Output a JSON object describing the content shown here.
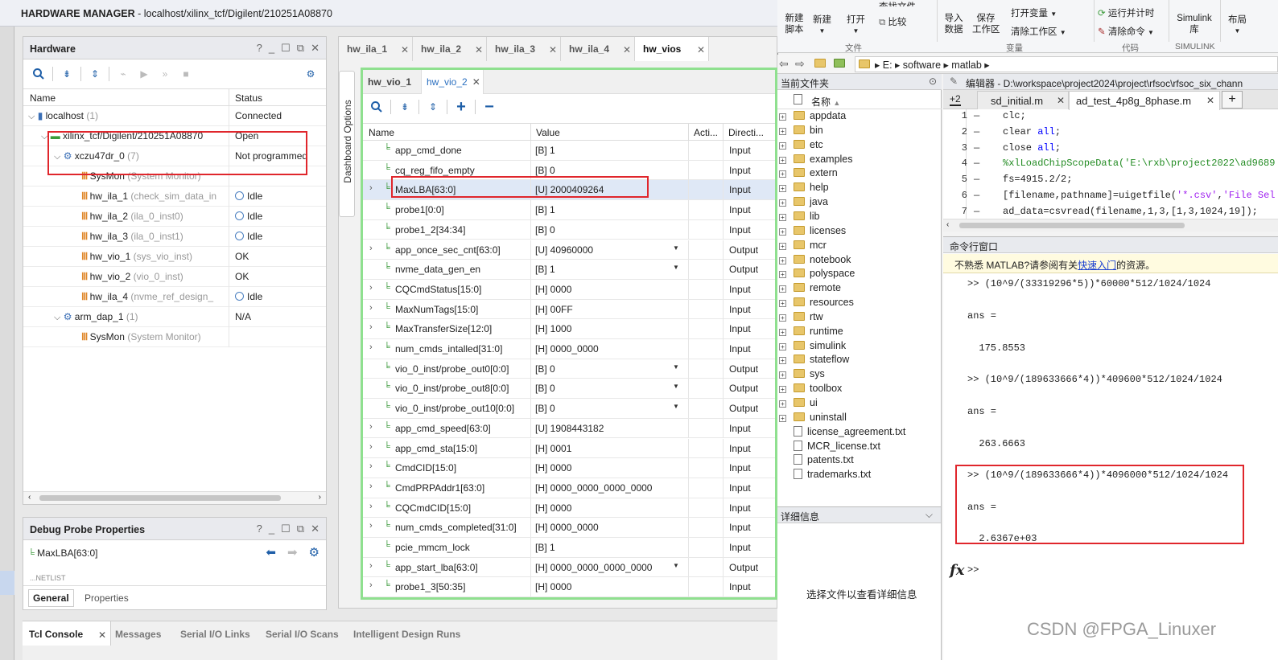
{
  "vivado": {
    "title_bold": "HARDWARE MANAGER",
    "title_rest": " - localhost/xilinx_tcf/Digilent/210251A08870",
    "hardware": {
      "title": "Hardware",
      "col_name": "Name",
      "col_status": "Status",
      "rows": [
        {
          "name": "localhost",
          "extra": " (1)",
          "status": "Connected"
        },
        {
          "name": "xilinx_tcf/Digilent/210251A08870",
          "extra": "",
          "status": "Open"
        },
        {
          "name": "xczu47dr_0",
          "extra": " (7)",
          "status": "Not programmed"
        },
        {
          "name": "SysMon",
          "extra": " (System Monitor)",
          "status": ""
        },
        {
          "name": "hw_ila_1",
          "extra": " (check_sim_data_in",
          "status": "Idle"
        },
        {
          "name": "hw_ila_2",
          "extra": " (ila_0_inst0)",
          "status": "Idle"
        },
        {
          "name": "hw_ila_3",
          "extra": " (ila_0_inst1)",
          "status": "Idle"
        },
        {
          "name": "hw_vio_1",
          "extra": " (sys_vio_inst)",
          "status": "OK"
        },
        {
          "name": "hw_vio_2",
          "extra": " (vio_0_inst)",
          "status": "OK"
        },
        {
          "name": "hw_ila_4",
          "extra": " (nvme_ref_design_",
          "status": "Idle"
        },
        {
          "name": "arm_dap_1",
          "extra": " (1)",
          "status": "N/A"
        },
        {
          "name": "SysMon",
          "extra": " (System Monitor)",
          "status": ""
        }
      ]
    },
    "debug_probe": {
      "title": "Debug Probe Properties",
      "selected": "MaxLBA[63:0]",
      "partial": "...NETLIST",
      "tab_general": "General",
      "tab_properties": "Properties"
    },
    "dashboard_tabs": [
      "hw_ila_1",
      "hw_ila_2",
      "hw_ila_3",
      "hw_ila_4",
      "hw_vios"
    ],
    "dashboard_options": "Dashboard Options",
    "vio_tabs": [
      "hw_vio_1",
      "hw_vio_2"
    ],
    "vio_cols": {
      "name": "Name",
      "value": "Value",
      "activity": "Acti...",
      "direction": "Directi..."
    },
    "vio_rows": [
      {
        "name": "app_cmd_done",
        "value": "[B] 1",
        "dir": "Input",
        "exp": false,
        "dd": false
      },
      {
        "name": "cq_reg_fifo_empty",
        "value": "[B] 0",
        "dir": "Input",
        "exp": false,
        "dd": false
      },
      {
        "name": "MaxLBA[63:0]",
        "value": "[U] 2000409264",
        "dir": "Input",
        "exp": true,
        "dd": false
      },
      {
        "name": "probe1[0:0]",
        "value": "[B] 1",
        "dir": "Input",
        "exp": false,
        "dd": false
      },
      {
        "name": "probe1_2[34:34]",
        "value": "[B] 0",
        "dir": "Input",
        "exp": false,
        "dd": false
      },
      {
        "name": "app_once_sec_cnt[63:0]",
        "value": "[U] 40960000",
        "dir": "Output",
        "exp": true,
        "dd": true
      },
      {
        "name": "nvme_data_gen_en",
        "value": "[B] 1",
        "dir": "Output",
        "exp": false,
        "dd": true
      },
      {
        "name": "CQCmdStatus[15:0]",
        "value": "[H] 0000",
        "dir": "Input",
        "exp": true,
        "dd": false
      },
      {
        "name": "MaxNumTags[15:0]",
        "value": "[H] 00FF",
        "dir": "Input",
        "exp": true,
        "dd": false
      },
      {
        "name": "MaxTransferSize[12:0]",
        "value": "[H] 1000",
        "dir": "Input",
        "exp": true,
        "dd": false
      },
      {
        "name": "num_cmds_intalled[31:0]",
        "value": "[H] 0000_0000",
        "dir": "Input",
        "exp": true,
        "dd": false
      },
      {
        "name": "vio_0_inst/probe_out0[0:0]",
        "value": "[B] 0",
        "dir": "Output",
        "exp": false,
        "dd": true
      },
      {
        "name": "vio_0_inst/probe_out8[0:0]",
        "value": "[B] 0",
        "dir": "Output",
        "exp": false,
        "dd": true
      },
      {
        "name": "vio_0_inst/probe_out10[0:0]",
        "value": "[B] 0",
        "dir": "Output",
        "exp": false,
        "dd": true
      },
      {
        "name": "app_cmd_speed[63:0]",
        "value": "[U] 1908443182",
        "dir": "Input",
        "exp": true,
        "dd": false
      },
      {
        "name": "app_cmd_sta[15:0]",
        "value": "[H] 0001",
        "dir": "Input",
        "exp": true,
        "dd": false
      },
      {
        "name": "CmdCID[15:0]",
        "value": "[H] 0000",
        "dir": "Input",
        "exp": true,
        "dd": false
      },
      {
        "name": "CmdPRPAddr1[63:0]",
        "value": "[H] 0000_0000_0000_0000",
        "dir": "Input",
        "exp": true,
        "dd": false
      },
      {
        "name": "CQCmdCID[15:0]",
        "value": "[H] 0000",
        "dir": "Input",
        "exp": true,
        "dd": false
      },
      {
        "name": "num_cmds_completed[31:0]",
        "value": "[H] 0000_0000",
        "dir": "Input",
        "exp": true,
        "dd": false
      },
      {
        "name": "pcie_mmcm_lock",
        "value": "[B] 1",
        "dir": "Input",
        "exp": false,
        "dd": false
      },
      {
        "name": "app_start_lba[63:0]",
        "value": "[H] 0000_0000_0000_0000",
        "dir": "Output",
        "exp": true,
        "dd": true
      },
      {
        "name": "probe1_3[50:35]",
        "value": "[H] 0000",
        "dir": "Input",
        "exp": true,
        "dd": false
      }
    ],
    "bottom_tabs": [
      "Tcl Console",
      "Messages",
      "Serial I/O Links",
      "Serial I/O Scans",
      "Intelligent Design Runs"
    ]
  },
  "matlab": {
    "toolstrip": {
      "new_script": "新建\n脚本",
      "new": "新建",
      "open": "打开",
      "find_files": "查找文件",
      "compare": "比较",
      "import_data": "导入\n数据",
      "save_workspace": "保存\n工作区",
      "open_variable": "打开变量",
      "clear_workspace": "清除工作区",
      "run_and_time": "运行并计时",
      "clear_commands": "清除命令",
      "simulink": "Simulink\n库",
      "layout": "布局",
      "sec_file": "文件",
      "sec_variable": "变量",
      "sec_code": "代码",
      "sec_simulink": "SIMULINK"
    },
    "path": [
      "E:",
      "software",
      "matlab"
    ],
    "current_folder": {
      "title": "当前文件夹",
      "col_name": "名称",
      "folders": [
        "appdata",
        "bin",
        "etc",
        "examples",
        "extern",
        "help",
        "java",
        "lib",
        "licenses",
        "mcr",
        "notebook",
        "polyspace",
        "remote",
        "resources",
        "rtw",
        "runtime",
        "simulink",
        "stateflow",
        "sys",
        "toolbox",
        "ui",
        "uninstall"
      ],
      "files": [
        "license_agreement.txt",
        "MCR_license.txt",
        "patents.txt",
        "trademarks.txt"
      ]
    },
    "details": {
      "title": "详细信息",
      "hint": "选择文件以查看详细信息"
    },
    "editor": {
      "title": "编辑器 - D:\\workspace\\project2024\\project\\rfsoc\\rfsoc_six_chann",
      "tab_more": "+2",
      "tabs": [
        "sd_initial.m",
        "ad_test_4p8g_8phase.m"
      ],
      "lines": [
        {
          "n": "1",
          "parts": [
            [
              "",
              "clc;"
            ]
          ]
        },
        {
          "n": "2",
          "parts": [
            [
              "",
              "clear "
            ],
            [
              "kw",
              "all"
            ],
            [
              "",
              ";"
            ]
          ]
        },
        {
          "n": "3",
          "parts": [
            [
              "",
              "close "
            ],
            [
              "kw",
              "all"
            ],
            [
              "",
              ";"
            ]
          ]
        },
        {
          "n": "4",
          "parts": [
            [
              "cm",
              "%xlLoadChipScopeData('E:\\rxb\\project2022\\ad9689"
            ]
          ]
        },
        {
          "n": "5",
          "parts": [
            [
              "",
              "fs=4915.2/2;"
            ]
          ]
        },
        {
          "n": "6",
          "parts": [
            [
              "",
              "[filename,pathname]=uigetfile("
            ],
            [
              "str",
              "'*.csv'"
            ],
            [
              "",
              ","
            ],
            [
              "str",
              "'File Sel"
            ]
          ]
        },
        {
          "n": "7",
          "parts": [
            [
              "",
              "ad_data=csvread(filename,1,3,[1,3,1024,19]);"
            ]
          ]
        }
      ]
    },
    "command_window": {
      "title": "命令行窗口",
      "notice_pre": "不熟悉 MATLAB?请参阅有关",
      "notice_link": "快速入门",
      "notice_post": "的资源。",
      "cmd1": ">> (10^9/(33319296*5))*60000*512/1024/1024",
      "ans1_label": "ans =",
      "ans1": "  175.8553",
      "cmd2": ">> (10^9/(189633666*4))*409600*512/1024/1024",
      "ans2_label": "ans =",
      "ans2": "  263.6663",
      "cmd3": ">> (10^9/(189633666*4))*4096000*512/1024/1024",
      "ans3_label": "ans =",
      "ans3": "  2.6367e+03",
      "prompt": ">>",
      "fx": "fx"
    }
  },
  "watermark": "CSDN @FPGA_Linuxer"
}
